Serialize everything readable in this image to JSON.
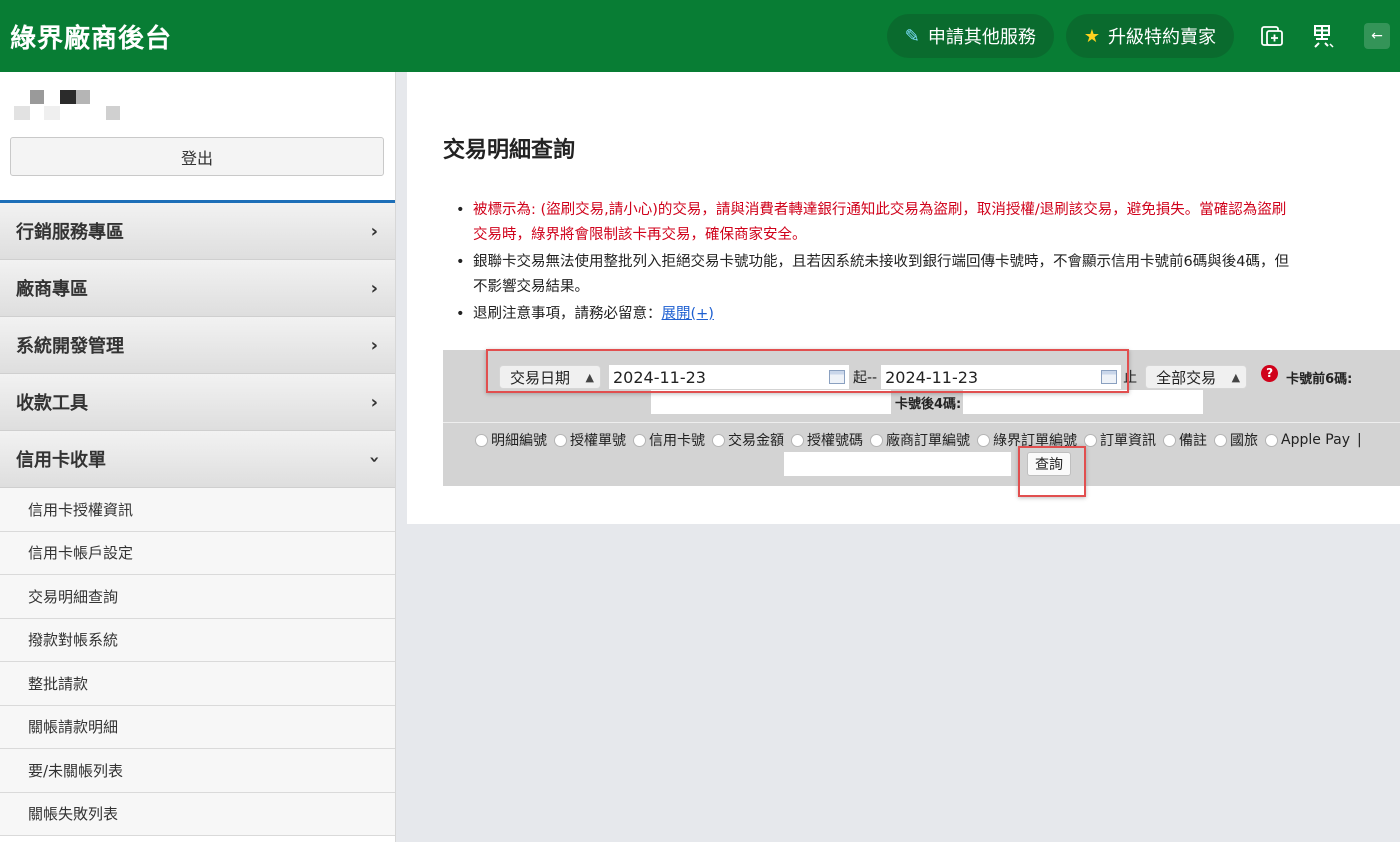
{
  "header": {
    "brand": "綠界廠商後台",
    "apply_service": "申請其他服務",
    "upgrade_seller": "升級特約賣家",
    "accent": "#087d34"
  },
  "sidebar": {
    "logout": "登出",
    "menu": [
      {
        "label": "行銷服務專區",
        "icon": "chevron-right-icon"
      },
      {
        "label": "廠商專區",
        "icon": "chevron-right-icon"
      },
      {
        "label": "系統開發管理",
        "icon": "chevron-right-icon"
      },
      {
        "label": "收款工具",
        "icon": "chevron-right-icon"
      },
      {
        "label": "信用卡收單",
        "icon": "chevron-down-icon"
      }
    ],
    "submenu": [
      "信用卡授權資訊",
      "信用卡帳戶設定",
      "交易明細查詢",
      "撥款對帳系統",
      "整批請款",
      "關帳請款明細",
      "要/未關帳列表",
      "關帳失敗列表"
    ]
  },
  "main": {
    "title": "交易明細查詢",
    "notes": {
      "fraud_warning_line1": "被標示為: (盜刷交易,請小心)的交易，請與消費者轉達銀行通知此交易為盜刷，取消授權/退刷該交易，避免損失。當確認為盜刷",
      "fraud_warning_line2": "交易時，綠界將會限制該卡再交易，確保商家安全。",
      "unionpay_line1": "銀聯卡交易無法使用整批列入拒絕交易卡號功能，且若因系統未接收到銀行端回傳卡號時，不會顯示信用卡號前6碼與後4碼，但",
      "unionpay_line2": "不影響交易結果。",
      "refund_prefix": "退刷注意事項，請務必留意：",
      "refund_link": "展開(+)",
      "warning_color": "#d0021b"
    },
    "form": {
      "date_type": "交易日期",
      "start_date": "2024-11-23",
      "start_suffix": "起--",
      "end_date": "2024-11-23",
      "end_suffix": "止",
      "txn_filter": "全部交易",
      "card_first6_label": "卡號前6碼:",
      "card_last4_label": "卡號後4碼:",
      "search_options": [
        "明細編號",
        "授權單號",
        "信用卡號",
        "交易金額",
        "授權號碼",
        "廠商訂單編號",
        "綠界訂單編號",
        "訂單資訊",
        "備註",
        "國旅",
        "Apple Pay"
      ],
      "options_trailer": "|",
      "query_button": "查詢"
    }
  }
}
